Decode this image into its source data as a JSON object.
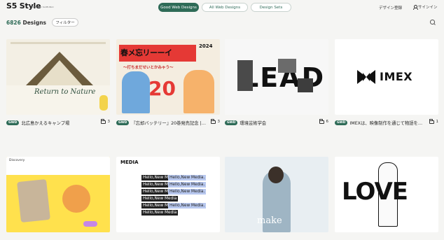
{
  "header": {
    "logo": "S5 Style",
    "logo_sub": "SAMURAI SAMURAI",
    "tabs": [
      "Good Web Designs",
      "All Web Designs",
      "Design Sets"
    ],
    "register": "デザイン登録",
    "signin": "サインイン"
  },
  "toolbar": {
    "count_number": "6826",
    "count_label": "Designs",
    "filter": "フィルター"
  },
  "cards": [
    {
      "badge": "GWD",
      "title": "北広島かえるキャンプ場",
      "count": "3",
      "thumb": {
        "text": "Return to Nature"
      }
    },
    {
      "badge": "GWD",
      "title": "『忘却バッテリー』20巻発売記念 | ...",
      "count": "3",
      "thumb": {
        "banner": "春メ忘リーーイ",
        "sub": "〜打ちまだせいとかみゃう〜",
        "number": "20",
        "year": "2024"
      }
    },
    {
      "badge": "GWD",
      "title": "環境芸術学会",
      "count": "6",
      "thumb": {
        "text": "LEAD"
      }
    },
    {
      "badge": "GWD",
      "title": "IMEXは、映像制作を通じて物語を形...",
      "count": "1",
      "thumb": {
        "text": "IMEX"
      }
    },
    {
      "badge": "",
      "title": "",
      "count": "",
      "thumb": {
        "text": "Discovery"
      }
    },
    {
      "badge": "",
      "title": "",
      "count": "",
      "thumb": {
        "brand": "MEDIA",
        "hello": "Hello,New Media",
        "hl": "Hello,New Media."
      }
    },
    {
      "badge": "",
      "title": "",
      "count": "",
      "thumb": {
        "text": "make"
      }
    },
    {
      "badge": "",
      "title": "",
      "count": "",
      "thumb": {
        "text": "LOVE"
      }
    }
  ]
}
